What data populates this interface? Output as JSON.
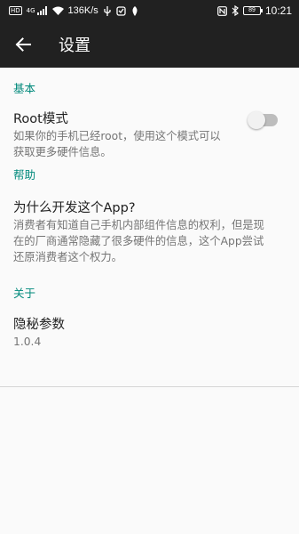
{
  "status_bar": {
    "badge": "HD",
    "network": "4G",
    "speed": "136K/s",
    "battery": "89",
    "time": "10:21",
    "icons": [
      "signal-icon",
      "wifi-icon",
      "usb-icon",
      "notification-icon",
      "nfc-icon",
      "bluetooth-icon",
      "battery-icon"
    ]
  },
  "toolbar": {
    "title": "设置",
    "back_icon": "arrow-back-icon"
  },
  "sections": [
    {
      "header": "基本",
      "items": [
        {
          "title": "Root模式",
          "summary_lines": [
            "如果你的手机已经root，使用这个模式可以",
            "获取更多硬件信息。"
          ],
          "switch_on": false
        }
      ]
    },
    {
      "header": "帮助",
      "items": [
        {
          "title": "为什么开发这个App?",
          "summary_lines": [
            "消费者有知道自己手机内部组件信息的权利，但是现",
            "在的厂商通常隐藏了很多硬件的信息，这个App尝试",
            "还原消费者这个权力。"
          ]
        }
      ]
    },
    {
      "header": "关于",
      "items": [
        {
          "title": "隐秘参数",
          "summary_lines": [
            "1.0.4"
          ]
        }
      ]
    }
  ],
  "colors": {
    "toolbar": "#212121",
    "accent": "#00897b",
    "background": "#fafafa",
    "title_text": "#212121",
    "summary_text": "#757575"
  }
}
